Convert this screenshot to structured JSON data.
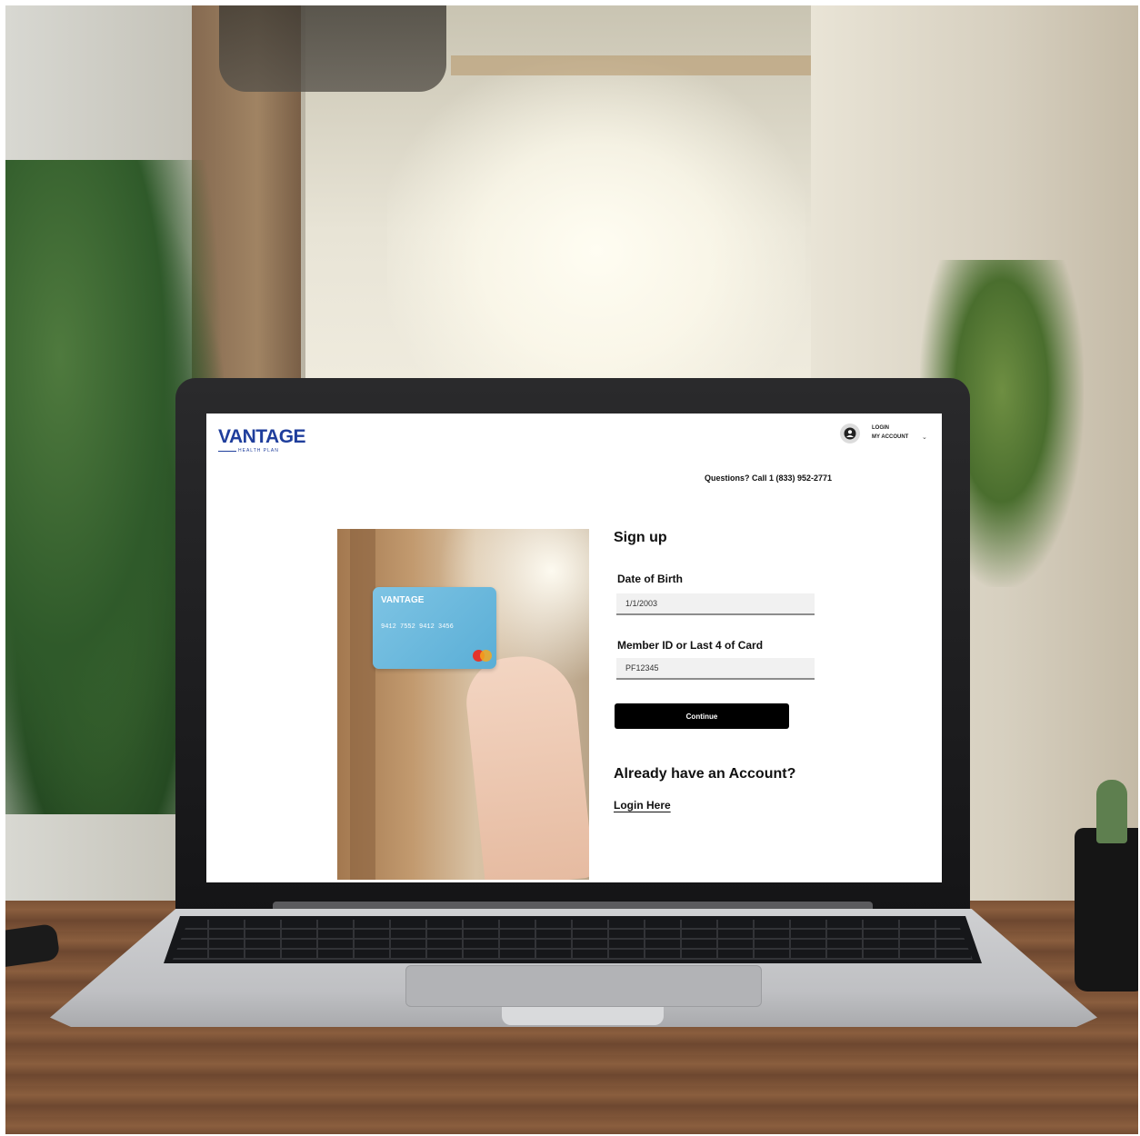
{
  "header": {
    "logo_text": "VANTAGE",
    "logo_subtext": "HEALTH PLAN",
    "account_login": "LOGIN",
    "account_my": "MY ACCOUNT",
    "account_chevron": "⌄",
    "questions_text": "Questions? Call 1 (833) 952-2771"
  },
  "image": {
    "card_logo": "VANTAGE",
    "card_number": "9412 7552 9412 3456"
  },
  "form": {
    "title": "Sign up",
    "dob_label": "Date of Birth",
    "dob_value": "1/1/2003",
    "member_label": "Member ID or Last 4 of Card",
    "member_value": "PF12345",
    "continue_label": "Continue"
  },
  "footer": {
    "already_text": "Already have an  Account?",
    "login_link": "Login Here"
  },
  "icons": {
    "account": "user-circle-icon",
    "chevron": "chevron-down-icon"
  },
  "colors": {
    "brand": "#1f3e9c",
    "button_bg": "#000000",
    "input_bg": "#f1f1f1"
  }
}
